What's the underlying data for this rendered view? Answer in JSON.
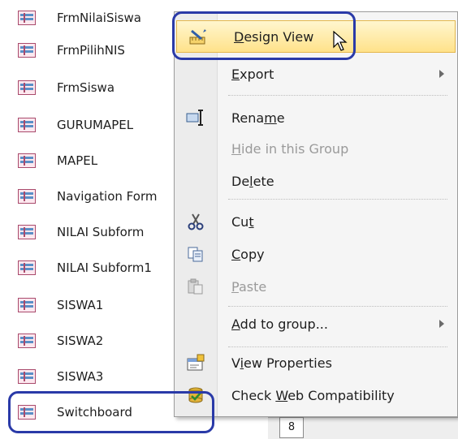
{
  "nav": {
    "items": [
      {
        "label": "FrmNilaiSiswa"
      },
      {
        "label": "FrmPilihNIS"
      },
      {
        "label": "FrmSiswa"
      },
      {
        "label": "GURUMAPEL"
      },
      {
        "label": "MAPEL"
      },
      {
        "label": "Navigation Form"
      },
      {
        "label": "NILAI Subform"
      },
      {
        "label": "NILAI Subform1"
      },
      {
        "label": "SISWA1"
      },
      {
        "label": "SISWA2"
      },
      {
        "label": "SISWA3"
      },
      {
        "label": "Switchboard"
      }
    ]
  },
  "menu": {
    "design_view": {
      "pre": "",
      "key": "D",
      "post": "esign View"
    },
    "export": {
      "pre": "",
      "key": "E",
      "post": "xport"
    },
    "rename": {
      "pre": "Rena",
      "key": "m",
      "post": "e"
    },
    "hide": {
      "pre": "",
      "key": "H",
      "post": "ide in this Group"
    },
    "delete": {
      "pre": "De",
      "key": "l",
      "post": "ete"
    },
    "cut": {
      "pre": "Cu",
      "key": "t",
      "post": ""
    },
    "copy": {
      "pre": "",
      "key": "C",
      "post": "opy"
    },
    "paste": {
      "pre": "",
      "key": "P",
      "post": "aste"
    },
    "add_to_group": {
      "pre": "",
      "key": "A",
      "post": "dd to group..."
    },
    "view_properties": {
      "pre": "V",
      "key": "i",
      "post": "ew Properties"
    },
    "check_web": {
      "pre": "Check ",
      "key": "W",
      "post": "eb Compatibility"
    }
  },
  "status": {
    "page_number": "8"
  },
  "colors": {
    "annotation": "#2a3aa8",
    "highlight_top": "#fff6cf",
    "highlight_bottom": "#ffe28a"
  }
}
